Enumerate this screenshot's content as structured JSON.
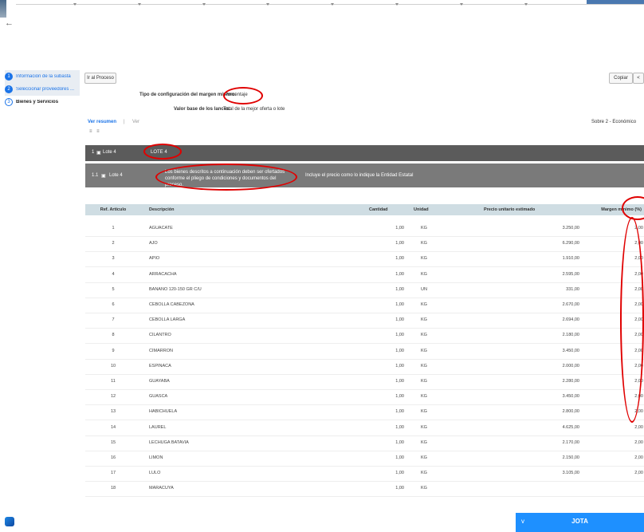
{
  "nav": {
    "back_icon": "arrow-left-icon",
    "steps": [
      {
        "num": "1",
        "label": "Información de la subasta"
      },
      {
        "num": "2",
        "label": "Seleccionar proveedores ..."
      },
      {
        "num": "3",
        "label": "Bienes y Servicios"
      }
    ]
  },
  "toolbar": {
    "go_to_process": "Ir al Proceso",
    "copy": "Copiar",
    "prev": "<"
  },
  "config": {
    "margin_label": "Tipo de configuración del margen mínimo:",
    "margin_value": "Porcentaje",
    "base_label": "Valor base de los lances:",
    "base_value": "Total de la mejor oferta o lote"
  },
  "views": {
    "summary": "Ver resumen",
    "separator": "|",
    "more": "Ver",
    "sobre": "Sobre 2 - Económico",
    "mini_icons": "≡ ≡"
  },
  "lote": {
    "num": "1",
    "name": "Lote 4",
    "title": "LOTE 4"
  },
  "sublote": {
    "num": "1.1",
    "name": "Lote 4",
    "note": "Los bienes descritos a continuación deben ser ofertados conforme el pliego de condiciones y documentos del proceso.",
    "tax_note": "Incluye el precio como lo indique la Entidad Estatal"
  },
  "table": {
    "headers": {
      "ref": "Ref. Artículo",
      "desc": "Descripción",
      "qty": "Cantidad",
      "unit": "Unidad",
      "price": "Precio unitario estimado",
      "margin": "Margen mínimo (%)"
    },
    "rows": [
      {
        "ref": "1",
        "desc": "AGUACATE",
        "qty": "1,00",
        "unit": "KG",
        "price": "3.250,00",
        "margin": "2,00"
      },
      {
        "ref": "2",
        "desc": "AJO",
        "qty": "1,00",
        "unit": "KG",
        "price": "6.290,00",
        "margin": "2,00"
      },
      {
        "ref": "3",
        "desc": "APIO",
        "qty": "1,00",
        "unit": "KG",
        "price": "1.910,00",
        "margin": "2,00"
      },
      {
        "ref": "4",
        "desc": "ARRACACHA",
        "qty": "1,00",
        "unit": "KG",
        "price": "2.595,00",
        "margin": "2,00"
      },
      {
        "ref": "5",
        "desc": "BANANO 120-150 GR C/U",
        "qty": "1,00",
        "unit": "UN",
        "price": "331,00",
        "margin": "2,00"
      },
      {
        "ref": "6",
        "desc": "CEBOLLA CABEZONA",
        "qty": "1,00",
        "unit": "KG",
        "price": "2.670,00",
        "margin": "2,00"
      },
      {
        "ref": "7",
        "desc": "CEBOLLA LARGA",
        "qty": "1,00",
        "unit": "KG",
        "price": "2.694,00",
        "margin": "2,00"
      },
      {
        "ref": "8",
        "desc": "CILANTRO",
        "qty": "1,00",
        "unit": "KG",
        "price": "2.180,00",
        "margin": "2,00"
      },
      {
        "ref": "9",
        "desc": "CIMARRON",
        "qty": "1,00",
        "unit": "KG",
        "price": "3.450,00",
        "margin": "2,00"
      },
      {
        "ref": "10",
        "desc": "ESPINACA",
        "qty": "1,00",
        "unit": "KG",
        "price": "2.000,00",
        "margin": "2,00"
      },
      {
        "ref": "11",
        "desc": "GUAYABA",
        "qty": "1,00",
        "unit": "KG",
        "price": "2.280,00",
        "margin": "2,00"
      },
      {
        "ref": "12",
        "desc": "GUASCA",
        "qty": "1,00",
        "unit": "KG",
        "price": "3.450,00",
        "margin": "2,00"
      },
      {
        "ref": "13",
        "desc": "HABICHUELA",
        "qty": "1,00",
        "unit": "KG",
        "price": "2.800,00",
        "margin": "2,00"
      },
      {
        "ref": "14",
        "desc": "LAUREL",
        "qty": "1,00",
        "unit": "KG",
        "price": "4.625,00",
        "margin": "2,00"
      },
      {
        "ref": "15",
        "desc": "LECHUGA BATAVIA",
        "qty": "1,00",
        "unit": "KG",
        "price": "2.170,00",
        "margin": "2,00"
      },
      {
        "ref": "16",
        "desc": "LIMON",
        "qty": "1,00",
        "unit": "KG",
        "price": "2.150,00",
        "margin": "2,00"
      },
      {
        "ref": "17",
        "desc": "LULO",
        "qty": "1,00",
        "unit": "KG",
        "price": "3.105,00",
        "margin": "2,00"
      },
      {
        "ref": "18",
        "desc": "MARACUYA",
        "qty": "1,00",
        "unit": "KG",
        "price": "",
        "margin": ""
      }
    ]
  },
  "chat": {
    "name": "JOTA",
    "chevron": "v"
  },
  "colors": {
    "primary": "#1a73e8",
    "lote_bar": "#5b5b5b",
    "sublote_bar": "#7a7a7a",
    "table_header": "#cfdde3",
    "annotation": "#e00000",
    "chat": "#1e90ff"
  }
}
